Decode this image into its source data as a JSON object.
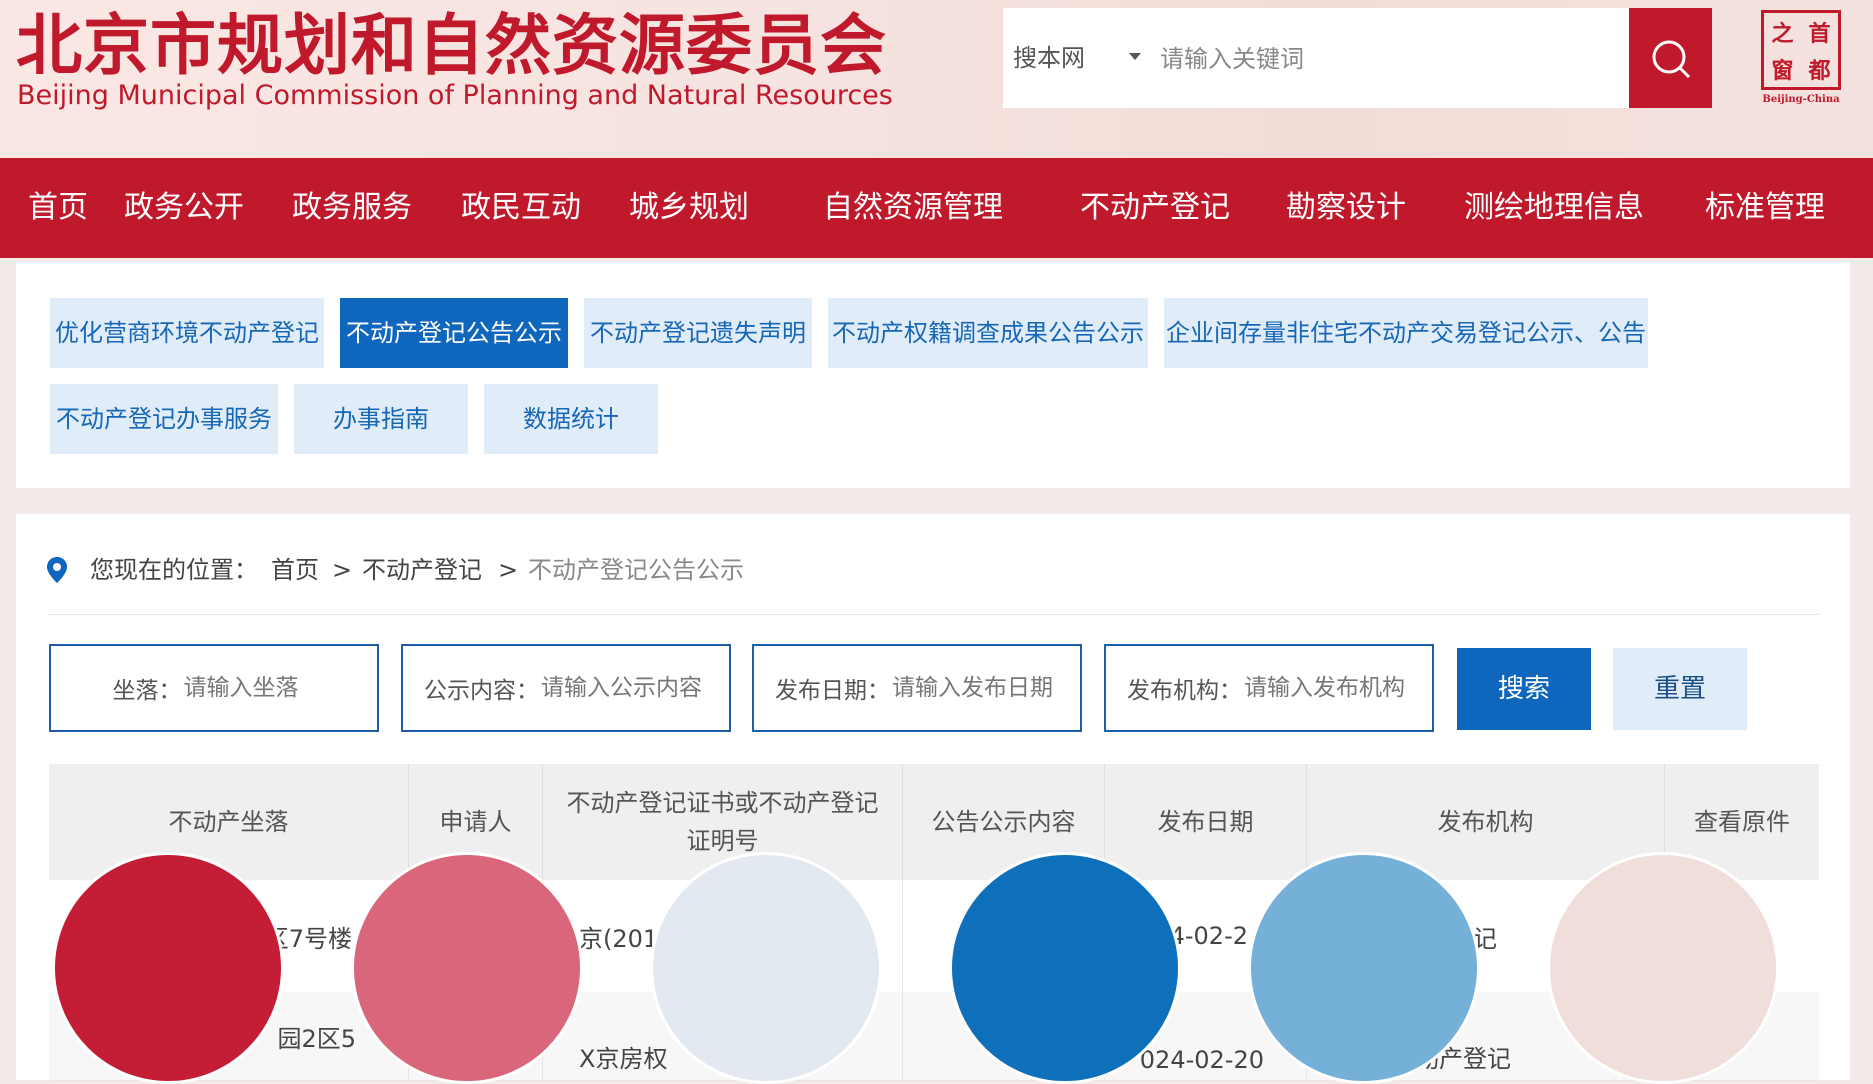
{
  "header": {
    "title": "北京市规划和自然资源委员会",
    "subtitle": "Beijing Municipal Commission of Planning and Natural Resources",
    "search": {
      "scope": "搜本网",
      "placeholder": "请输入关键词"
    },
    "logo": {
      "cells": [
        "之",
        "首",
        "窗",
        "都"
      ],
      "caption": "Beijing-China"
    }
  },
  "nav": {
    "items": [
      "首页",
      "政务公开",
      "政务服务",
      "政民互动",
      "城乡规划",
      "自然资源管理",
      "不动产登记",
      "勘察设计",
      "测绘地理信息",
      "标准管理"
    ]
  },
  "tabs": {
    "row1": [
      "优化营商环境不动产登记",
      "不动产登记公告公示",
      "不动产登记遗失声明",
      "不动产权籍调查成果公告公示",
      "企业间存量非住宅不动产交易登记公示、公告"
    ],
    "row2": [
      "不动产登记办事服务",
      "办事指南",
      "数据统计"
    ],
    "active": "不动产登记公告公示"
  },
  "breadcrumb": {
    "prefix": "您现在的位置：",
    "items": [
      "首页",
      "不动产登记",
      "不动产登记公告公示"
    ],
    "separator": ">"
  },
  "filters": [
    {
      "label": "坐落：",
      "placeholder": "请输入坐落"
    },
    {
      "label": "公示内容：",
      "placeholder": "请输入公示内容"
    },
    {
      "label": "发布日期：",
      "placeholder": "请输入发布日期"
    },
    {
      "label": "发布机构：",
      "placeholder": "请输入发布机构"
    }
  ],
  "buttons": {
    "search": "搜索",
    "reset": "重置"
  },
  "table": {
    "headers": [
      "不动产坐落",
      "申请人",
      "不动产登记证书或不动产登记证明号",
      "公告公示内容",
      "发布日期",
      "发布机构",
      "查看原件"
    ],
    "rows": [
      [
        "区7号楼",
        "",
        "京(201",
        "",
        "4-02-2",
        "产登记",
        ""
      ],
      [
        "园2区5",
        "",
        "X京房权",
        "",
        "024-02-20",
        "动产登记",
        ""
      ]
    ]
  },
  "swatches": [
    "#c41e36",
    "#d9667a",
    "#e3e9f1",
    "#0e6fbb",
    "#75b0d9",
    "#f0dedb"
  ]
}
